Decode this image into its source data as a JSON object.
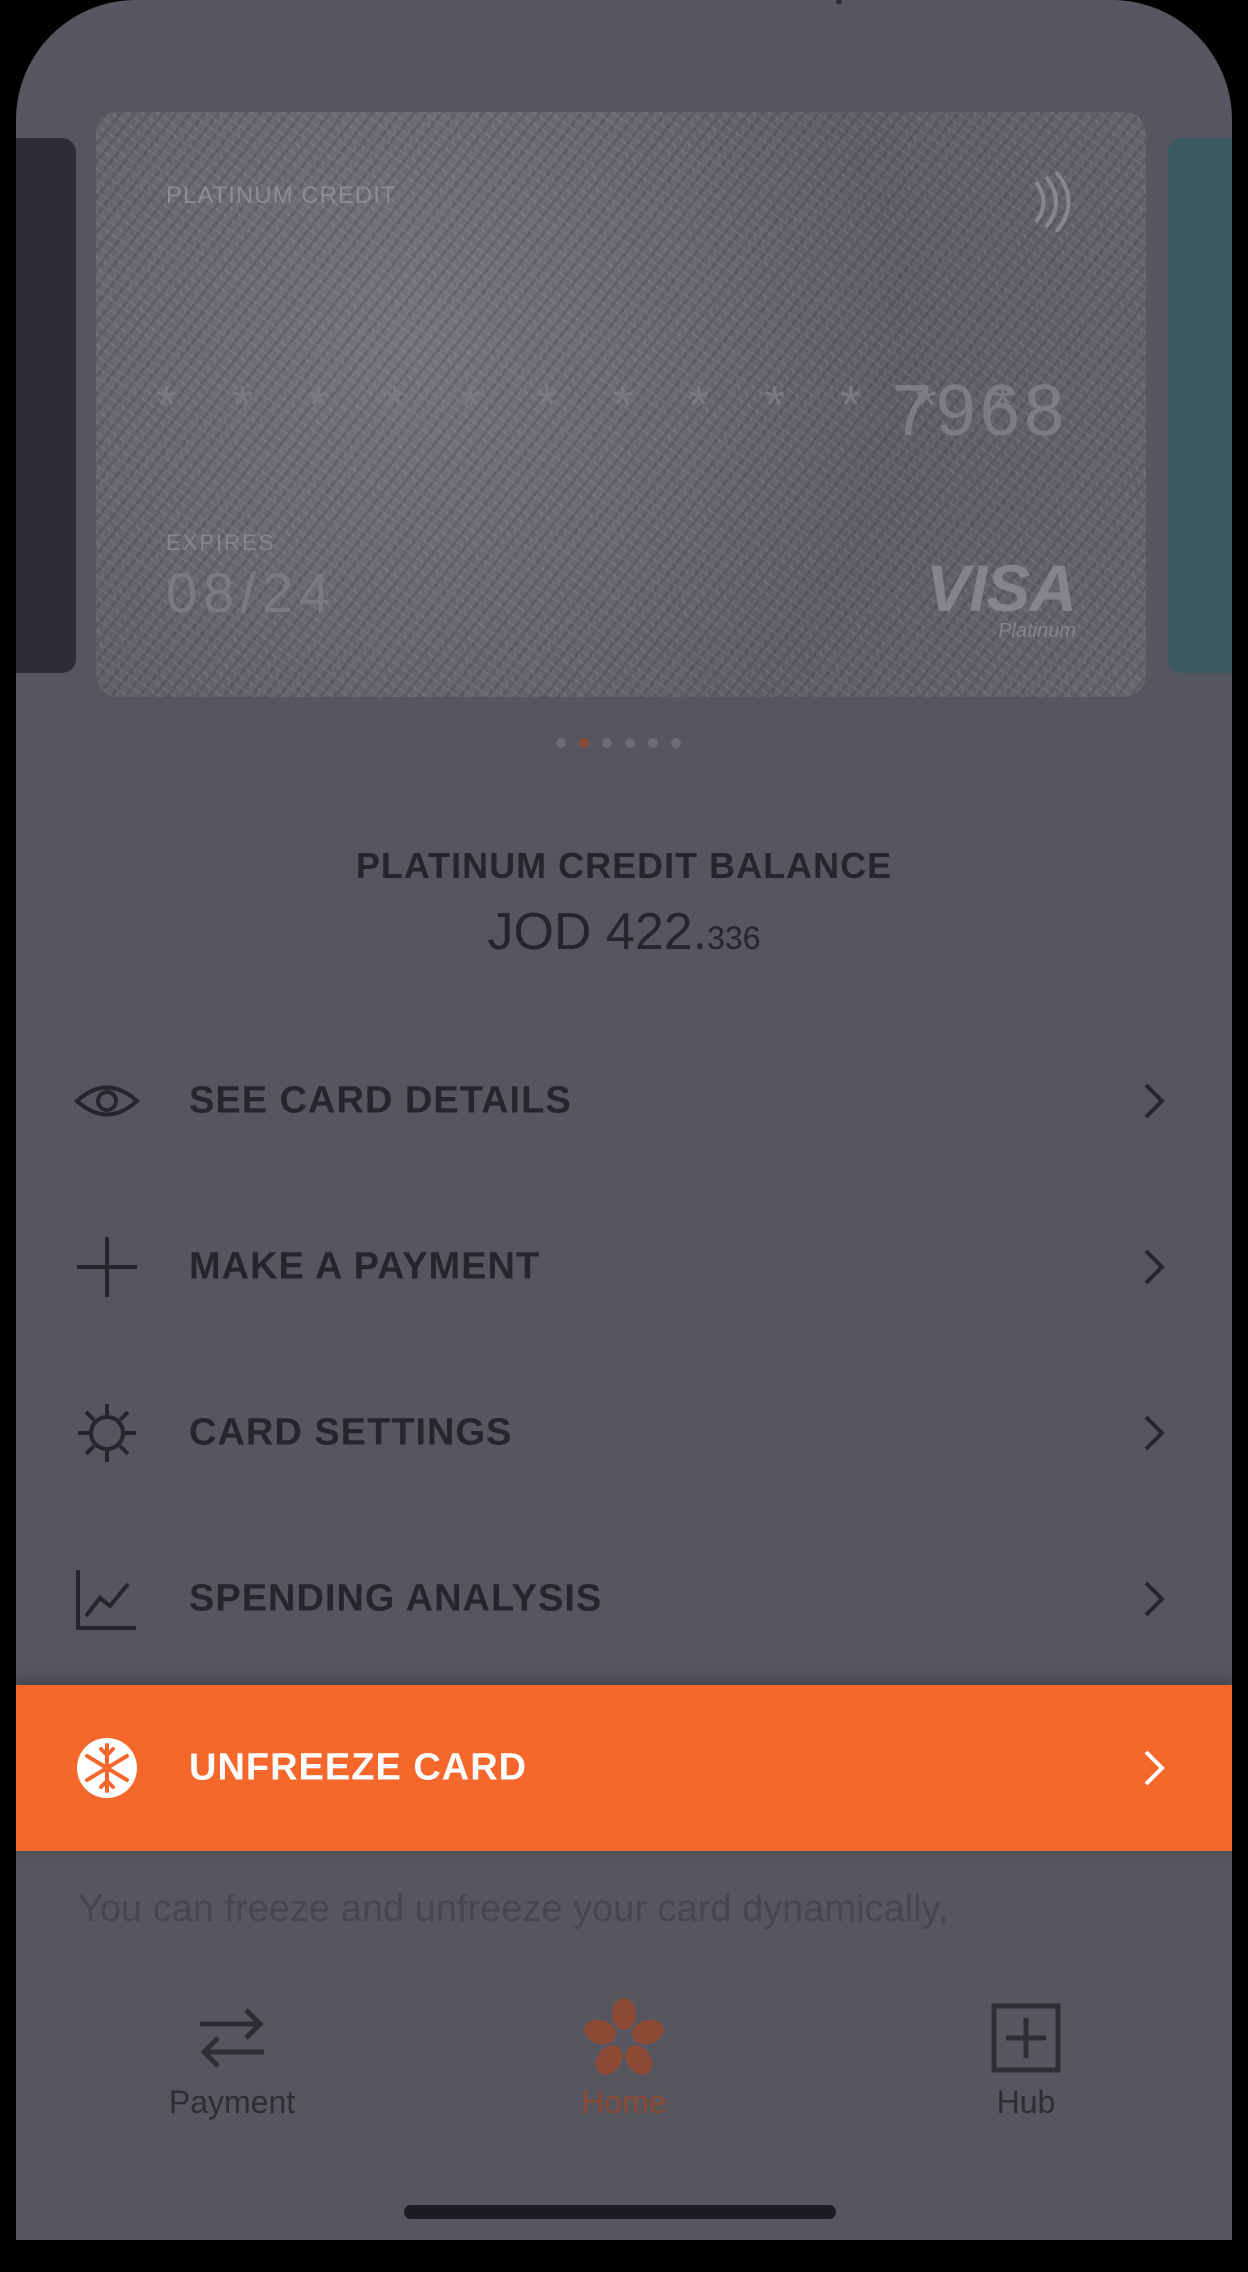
{
  "card": {
    "type_label": "PLATINUM CREDIT",
    "masked_number": "* * * *  * * * *  * * * *",
    "last4": "7968",
    "expires_label": "EXPIRES",
    "expiry": "08/24",
    "brand": "VISA",
    "brand_sub": "Platinum"
  },
  "carousel": {
    "count": 6,
    "active_index": 1
  },
  "balance": {
    "title": "PLATINUM CREDIT BALANCE",
    "amount_main": "JOD 422.",
    "amount_decimals": "336"
  },
  "menu": {
    "see_details": "SEE CARD DETAILS",
    "make_payment": "MAKE A PAYMENT",
    "card_settings": "CARD SETTINGS",
    "spending_analysis": "SPENDING ANALYSIS",
    "unfreeze_card": "UNFREEZE CARD"
  },
  "info_text": "You can freeze and unfreeze your card dynamically,",
  "tabbar": {
    "payment": "Payment",
    "home": "Home",
    "hub": "Hub"
  },
  "colors": {
    "accent": "#f5672b",
    "overlay_bg": "#565660",
    "active_tab": "#8c4a35"
  },
  "icons": {
    "see_details": "eye-icon",
    "make_payment": "plus-icon",
    "card_settings": "gear-icon",
    "spending_analysis": "chart-icon",
    "unfreeze_card": "snowflake-icon"
  }
}
